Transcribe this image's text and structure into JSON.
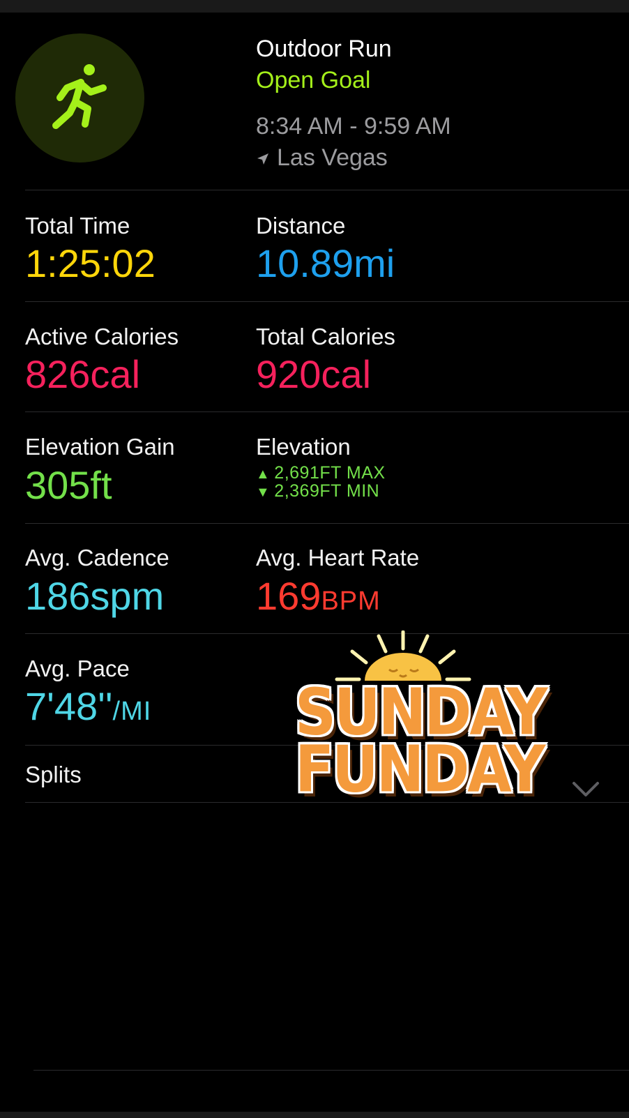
{
  "header": {
    "workout_type": "Outdoor Run",
    "goal": "Open Goal",
    "time_range": "8:34 AM - 9:59 AM",
    "location": "Las Vegas",
    "icon": "running-figure-icon"
  },
  "stats": {
    "total_time": {
      "label": "Total Time",
      "value": "1:25:02",
      "color": "#ffd60a"
    },
    "distance": {
      "label": "Distance",
      "value": "10.89mi",
      "color": "#1ea0ee"
    },
    "active_calories": {
      "label": "Active Calories",
      "value": "826cal",
      "color": "#f5215c"
    },
    "total_calories": {
      "label": "Total Calories",
      "value": "920cal",
      "color": "#f5215c"
    },
    "elevation_gain": {
      "label": "Elevation Gain",
      "value": "305ft",
      "color": "#73e04a"
    },
    "elevation": {
      "label": "Elevation",
      "max_arrow": "▲",
      "max": "2,691FT MAX",
      "min_arrow": "▼",
      "min": "2,369FT MIN",
      "color": "#73e04a"
    },
    "avg_cadence": {
      "label": "Avg. Cadence",
      "value": "186spm",
      "color": "#4fd6e6"
    },
    "avg_heart_rate": {
      "label": "Avg. Heart Rate",
      "number": "169",
      "unit": "BPM",
      "color": "#ff3b30"
    },
    "avg_pace": {
      "label": "Avg. Pace",
      "number": "7'48''",
      "unit": "/MI",
      "color": "#4fd6e6"
    }
  },
  "splits": {
    "label": "Splits",
    "icon": "chevron-down-icon"
  },
  "sticker": {
    "line1": "SUNDAY",
    "line2": "FUNDAY",
    "icon": "sun-icon"
  }
}
